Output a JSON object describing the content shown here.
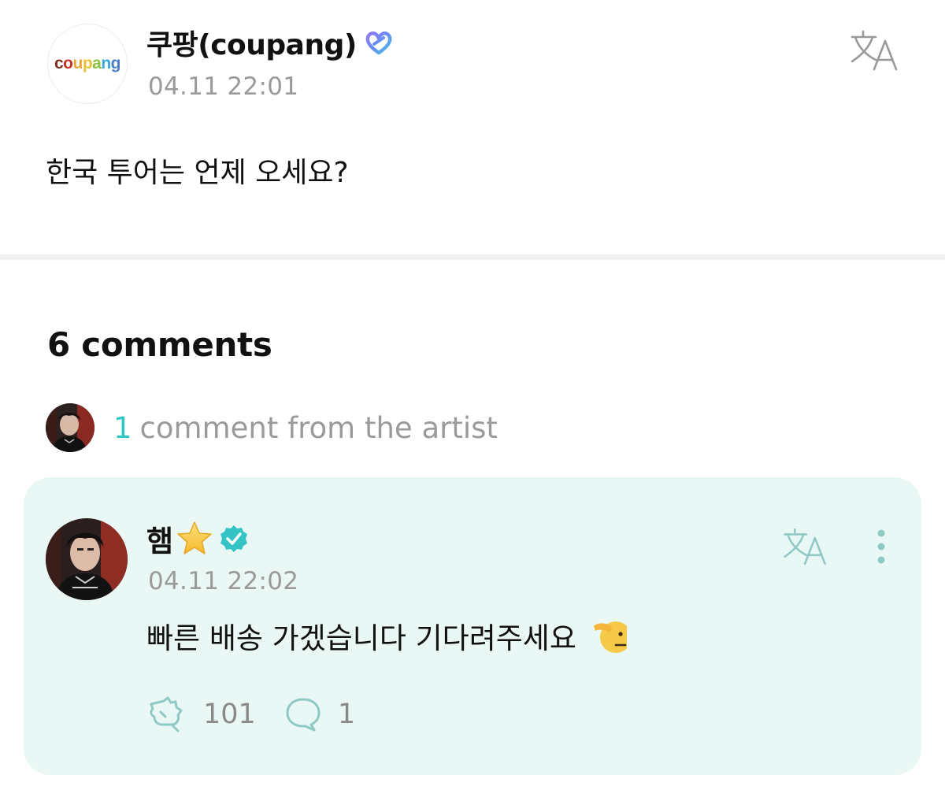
{
  "post": {
    "author": {
      "name": "쿠팡(coupang)",
      "avatar_logo_letters": [
        "c",
        "o",
        "u",
        "p",
        "a",
        "n",
        "g"
      ],
      "avatar_logo_colors": [
        "#7a2e1b",
        "#c9302c",
        "#e8a63a",
        "#e8c33a",
        "#8cbf3f",
        "#3aa6de",
        "#4b7fc4"
      ]
    },
    "timestamp": "04.11 22:01",
    "body": "한국 투어는 언제 오세요?"
  },
  "comments": {
    "count_label": "6 comments",
    "artist_summary": {
      "count": "1",
      "text": "comment from the artist"
    }
  },
  "artist_comment": {
    "author_name": "햄",
    "star_icon": "star-icon",
    "verified_icon": "verified-check-icon",
    "timestamp": "04.11 22:02",
    "text": "빠른 배송 가겠습니다 기다려주세요",
    "emoji_icon": "saluting-face-icon",
    "likes": "101",
    "replies": "1"
  },
  "colors": {
    "accent_teal": "#2fc6c4",
    "card_background": "#eaf8f5",
    "muted_text": "#9a9a9a"
  }
}
